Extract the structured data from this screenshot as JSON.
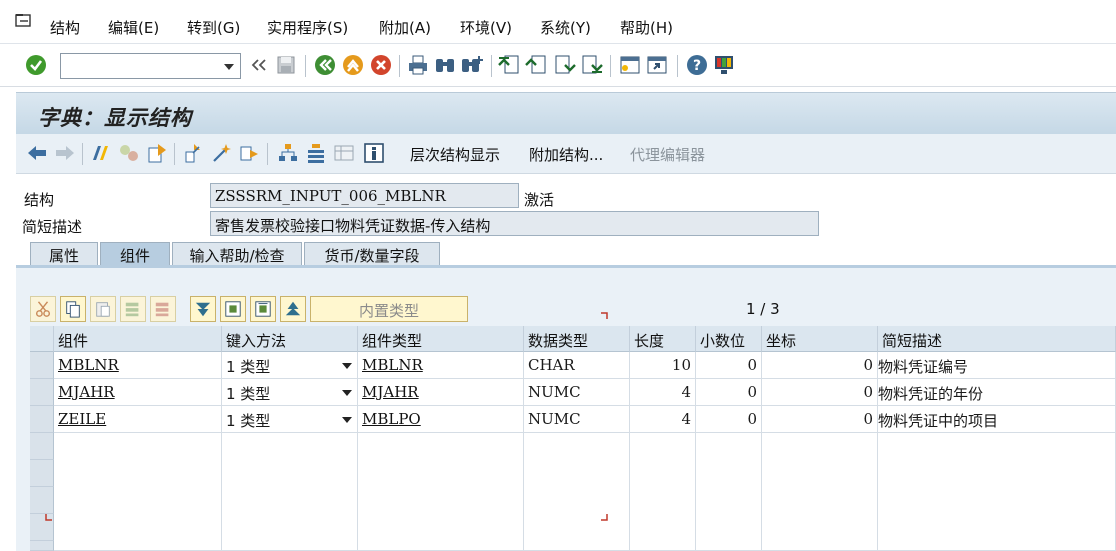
{
  "menubar": {
    "items": [
      "结构",
      "编辑(E)",
      "转到(G)",
      "实用程序(S)",
      "附加(A)",
      "环境(V)",
      "系统(Y)",
      "帮助(H)"
    ]
  },
  "toolbar": {
    "command_value": "",
    "icons": [
      "enter-icon",
      "back-double-arrow-icon",
      "save-icon",
      "back-icon",
      "exit-icon",
      "cancel-icon",
      "print-icon",
      "find-icon",
      "find-next-icon",
      "first-page-icon",
      "previous-page-icon",
      "next-page-icon",
      "last-page-icon",
      "new-session-icon",
      "shortcut-icon",
      "help-icon",
      "customize-layout-icon"
    ]
  },
  "title": "字典：显示结构",
  "app_toolbar": {
    "hierarchy_label": "层次结构显示",
    "append_label": "附加结构...",
    "proxy_editor_label": "代理编辑器"
  },
  "header": {
    "structure_label": "结构",
    "structure_value": "ZSSSRM_INPUT_006_MBLNR",
    "status_value": "激活",
    "short_desc_label": "简短描述",
    "short_desc_value": "寄售发票校验接口物料凭证数据-传入结构"
  },
  "tabs": [
    "属性",
    "组件",
    "输入帮助/检查",
    "货币/数量字段"
  ],
  "grid_toolbar": {
    "builtin_type_label": "内置类型",
    "pager": "1 / 3"
  },
  "table": {
    "columns": [
      "组件",
      "键入方法",
      "组件类型",
      "数据类型",
      "长度",
      "小数位",
      "坐标",
      "简短描述"
    ],
    "rows": [
      {
        "component": "MBLNR",
        "method": "1 类型",
        "comp_type": "MBLNR",
        "data_type": "CHAR",
        "length": "10",
        "decimals": "0",
        "coord": "0",
        "desc": "物料凭证编号"
      },
      {
        "component": "MJAHR",
        "method": "1 类型",
        "comp_type": "MJAHR",
        "data_type": "NUMC",
        "length": "4",
        "decimals": "0",
        "coord": "0",
        "desc": "物料凭证的年份"
      },
      {
        "component": "ZEILE",
        "method": "1 类型",
        "comp_type": "MBLPO",
        "data_type": "NUMC",
        "length": "4",
        "decimals": "0",
        "coord": "0",
        "desc": "物料凭证中的项目"
      }
    ]
  },
  "colors": {
    "title_bg": "#c5d8e6",
    "panel_bg": "#eaf1f7",
    "field_bg": "#e3e9ef",
    "grid_button_bg": "#fff7cf"
  }
}
